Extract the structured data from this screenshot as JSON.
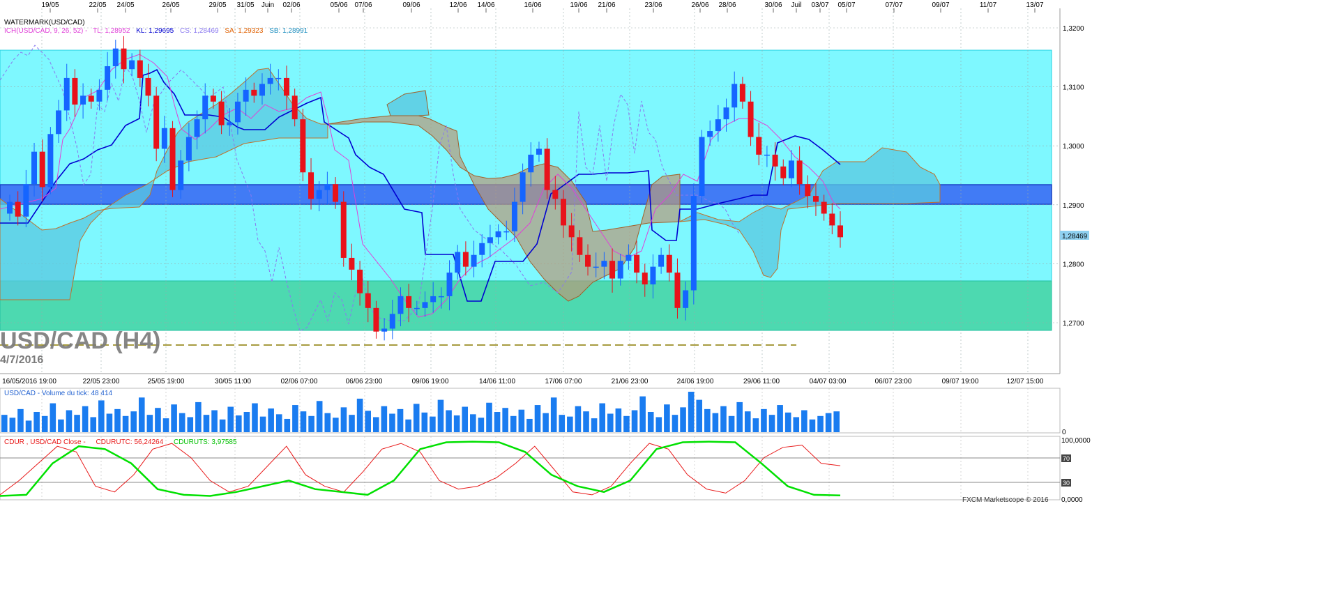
{
  "header": {
    "watermark_label": "WATERMARK(USD/CAD)",
    "ichimoku": {
      "prefix": "ICH(USD/CAD, 9, 26, 52) -",
      "tl": "TL: 1,28952",
      "kl": "KL: 1,29695",
      "cs": "CS: 1,28469",
      "sa": "SA: 1,29323",
      "sb": "SB: 1,28991"
    },
    "instrument_title": "USD/CAD (H4)",
    "date_text": "4/7/2016"
  },
  "volume_panel": {
    "label": "USD/CAD - Volume du tick: 48 414"
  },
  "cdur_panel": {
    "label": "CDUR , USD/CAD Close -",
    "utc_label": "CDURUTC: 56,24264",
    "uts_label": "CDURUTS: 3,97585"
  },
  "footer": {
    "credit": "FXCM Marketscope © 2016"
  },
  "last_price_tag": "1,28469",
  "colors": {
    "bull": "#1565ff",
    "bear": "#e8121a",
    "zone_cyan": "#7ef8ff",
    "zone_green": "#4dd9b0",
    "zone_blue": "#3b6ef5",
    "cloud_blue": "#5ac8e0",
    "cloud_brown": "#b89a7a",
    "tenkan": "#e040d8",
    "kijun": "#0000d0",
    "chikou": "#8a78f0",
    "cdur_red": "#e81818",
    "cdur_green": "#00e000",
    "volume": "#1a7cf0"
  },
  "chart_data": [
    {
      "type": "candlestick",
      "title": "USD/CAD (H4)",
      "top_axis_labels": [
        "19/05",
        "22/05",
        "24/05",
        "26/05",
        "29/05",
        "31/05",
        "Juin",
        "02/06",
        "05/06",
        "07/06",
        "09/06",
        "12/06",
        "14/06",
        "16/06",
        "19/06",
        "21/06",
        "23/06",
        "26/06",
        "28/06",
        "30/06",
        "Juil",
        "03/07",
        "05/07",
        "07/07",
        "09/07",
        "11/07",
        "13/07"
      ],
      "bottom_axis_labels": [
        "16/05/2016 19:00",
        "22/05 23:00",
        "25/05 19:00",
        "30/05 11:00",
        "02/06 07:00",
        "06/06 23:00",
        "09/06 19:00",
        "14/06 11:00",
        "17/06 07:00",
        "21/06 23:00",
        "24/06 19:00",
        "29/06 11:00",
        "04/07 03:00",
        "06/07 23:00",
        "09/07 19:00",
        "12/07 15:00"
      ],
      "y_ticks": [
        "1,3200",
        "1,3100",
        "1,3000",
        "1,2900",
        "1,2800",
        "1,2700"
      ],
      "ylim": [
        1.2625,
        1.3225
      ],
      "close_path": [
        1.2905,
        1.288,
        1.2935,
        1.299,
        1.293,
        1.302,
        1.306,
        1.3115,
        1.307,
        1.3085,
        1.3075,
        1.3095,
        1.3135,
        1.3165,
        1.313,
        1.3145,
        1.3115,
        1.3085,
        1.2995,
        1.303,
        1.2925,
        1.2975,
        1.3015,
        1.3045,
        1.3085,
        1.3075,
        1.3035,
        1.304,
        1.3075,
        1.3095,
        1.3085,
        1.3105,
        1.3115,
        1.3115,
        1.3085,
        1.3045,
        1.2955,
        1.291,
        1.2925,
        1.2935,
        1.2905,
        1.281,
        1.279,
        1.275,
        1.2725,
        1.2685,
        1.269,
        1.2715,
        1.2745,
        1.2725,
        1.2725,
        1.2735,
        1.2745,
        1.2745,
        1.2785,
        1.282,
        1.2795,
        1.2815,
        1.2835,
        1.2845,
        1.2855,
        1.2855,
        1.2905,
        1.2955,
        1.2985,
        1.2995,
        1.2925,
        1.291,
        1.2865,
        1.2845,
        1.2815,
        1.2795,
        1.2795,
        1.2805,
        1.2775,
        1.2805,
        1.2815,
        1.2785,
        1.2765,
        1.2795,
        1.2815,
        1.2785,
        1.2725,
        1.2755,
        1.2915,
        1.3015,
        1.3025,
        1.3045,
        1.3065,
        1.3105,
        1.3075,
        1.3015,
        1.2985,
        1.2985,
        1.2965,
        1.2945,
        1.2975,
        1.2935,
        1.2915,
        1.2905,
        1.2885,
        1.2865,
        1.2845
      ],
      "volume": [
        30,
        25,
        40,
        20,
        35,
        28,
        50,
        22,
        38,
        30,
        45,
        26,
        55,
        32,
        40,
        28,
        36,
        60,
        30,
        42,
        24,
        48,
        33,
        26,
        52,
        30,
        38,
        22,
        44,
        29,
        35,
        50,
        27,
        41,
        31,
        23,
        47,
        36,
        28,
        54,
        33,
        25,
        43,
        30,
        58,
        37,
        26,
        45,
        32,
        40,
        22,
        49,
        34,
        27,
        56,
        38,
        29,
        44,
        31,
        25,
        51,
        35,
        42,
        28,
        39,
        23,
        47,
        33,
        60,
        30,
        27,
        45,
        36,
        24,
        50,
        32,
        41,
        28,
        38,
        62,
        35,
        26,
        48,
        30,
        43,
        70,
        56,
        40,
        33,
        45,
        28,
        52,
        36,
        24,
        40,
        30,
        47,
        34,
        26,
        38,
        22,
        28,
        33,
        36
      ],
      "cdur_utc": [
        5,
        30,
        60,
        90,
        80,
        20,
        10,
        40,
        85,
        95,
        70,
        30,
        10,
        20,
        55,
        90,
        40,
        20,
        10,
        45,
        85,
        95,
        80,
        30,
        15,
        20,
        35,
        60,
        90,
        50,
        10,
        5,
        20,
        60,
        95,
        85,
        40,
        15,
        8,
        30,
        70,
        88,
        92,
        60,
        56
      ],
      "cdur_uts": [
        3,
        5,
        60,
        90,
        85,
        60,
        15,
        5,
        3,
        10,
        20,
        30,
        15,
        10,
        5,
        30,
        85,
        97,
        98,
        97,
        80,
        40,
        20,
        10,
        30,
        85,
        97,
        98,
        97,
        60,
        20,
        5,
        4
      ]
    }
  ]
}
